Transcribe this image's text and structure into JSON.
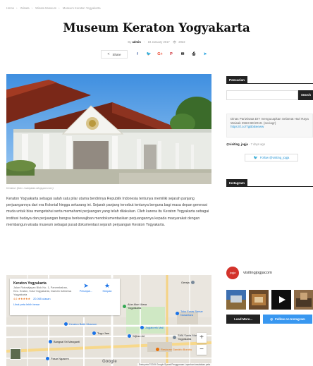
{
  "breadcrumb": [
    "Home",
    "Wisata",
    "Wisata Museum",
    "Museum Keraton Yogyakarta"
  ],
  "breadcrumb_separator": "›",
  "article": {
    "title": "Museum Keraton Yogyakarta",
    "author_prefix": "By",
    "author": "admin",
    "date": "19 January 2017",
    "views": "2022",
    "share_label": "Share",
    "image_caption": "Keraton (foto: mainjalan.blogspot.com)",
    "body": "Keraton Yogyakarta sebagai salah satu pilar utama berdirinya Republik Indonesia tentunya memiliki sejarah panjang perjuangannya dari era Kolonial hingga sekarang ini. Sejarah panjang tersebut tentunya berguna bagi masa depan generasi muda untuk bisa mengetahui serta memahami perjuangan yang telah dilakukan. Oleh karena itu Keraton Yogyakarta sebagai institusi budaya dan perjuangan bangsa berkewajiban mendokumentasikan perjuangannya kepada masyarakat dengan membangun wisata museum sebagai pusat dokumentasi sejarah perjuangan Keraton Yogyakarta."
  },
  "share_icons": [
    {
      "icon": "facebook-icon",
      "glyph": "f",
      "color": "#516eab"
    },
    {
      "icon": "twitter-icon",
      "glyph": "🐦",
      "color": "#29c5f6"
    },
    {
      "icon": "google-plus-icon",
      "glyph": "G+",
      "color": "#eb4026"
    },
    {
      "icon": "pinterest-icon",
      "glyph": "P",
      "color": "#ca212a"
    },
    {
      "icon": "email-icon",
      "glyph": "✉",
      "color": "#000000"
    },
    {
      "icon": "print-icon",
      "glyph": "⎙",
      "color": "#000000"
    },
    {
      "icon": "telegram-icon",
      "glyph": "➤",
      "color": "#179cde"
    }
  ],
  "map": {
    "place_title": "Keraton Yogyakarta",
    "address": "Jalan Rotowijayan Blok No. 1, Panembahan, Kec. Kraton, Kota Yogyakarta, Daerah Istimewa Yogyakarta",
    "rating": "4,6",
    "stars": "★★★★★",
    "reviews": "20.065 ulasan",
    "larger_map": "Lihat peta lebih besar",
    "directions": "Petunjuk...",
    "save": "Simpan",
    "zoom_in": "+",
    "zoom_out": "−",
    "google": "Google",
    "attribution": "Data peta ©2019 Google   Syarat Penggunaan   Laporkan kesalahan peta",
    "labels": [
      "Alun Alun Utara Yogyakarta",
      "Toko Emas Semar Nusantara",
      "Jogjatorrik Mall",
      "Keraton Batik Museum",
      "Tugu Jam",
      "Wijilan Art",
      "SMA Santa Maria Yogyakarta",
      "Bangsal Sri Manganti",
      "Restoran Gandrio Borobu",
      "Pasar Ngasem",
      "Gereja"
    ]
  },
  "sidebar": {
    "search": {
      "heading": "Pencarian",
      "placeholder": "",
      "button": "Search"
    },
    "twitter": {
      "tweet_text": "Dinas Pariwisata DIY mengucapkan Selamat Hari Raya Waisak 2563 BE/2019. (seviagr)",
      "tweet_link": "https://t.co/TgBbBeeww",
      "handle": "@visiting_jogja",
      "time": "7 days ago",
      "follow_label": "Follow @visiting_jogja"
    },
    "instagram": {
      "heading": "Instagram",
      "username": "visitingjogjacom",
      "avatar_text": "jogja",
      "load_more": "Load More...",
      "follow_label": "Follow on Instagram"
    }
  }
}
